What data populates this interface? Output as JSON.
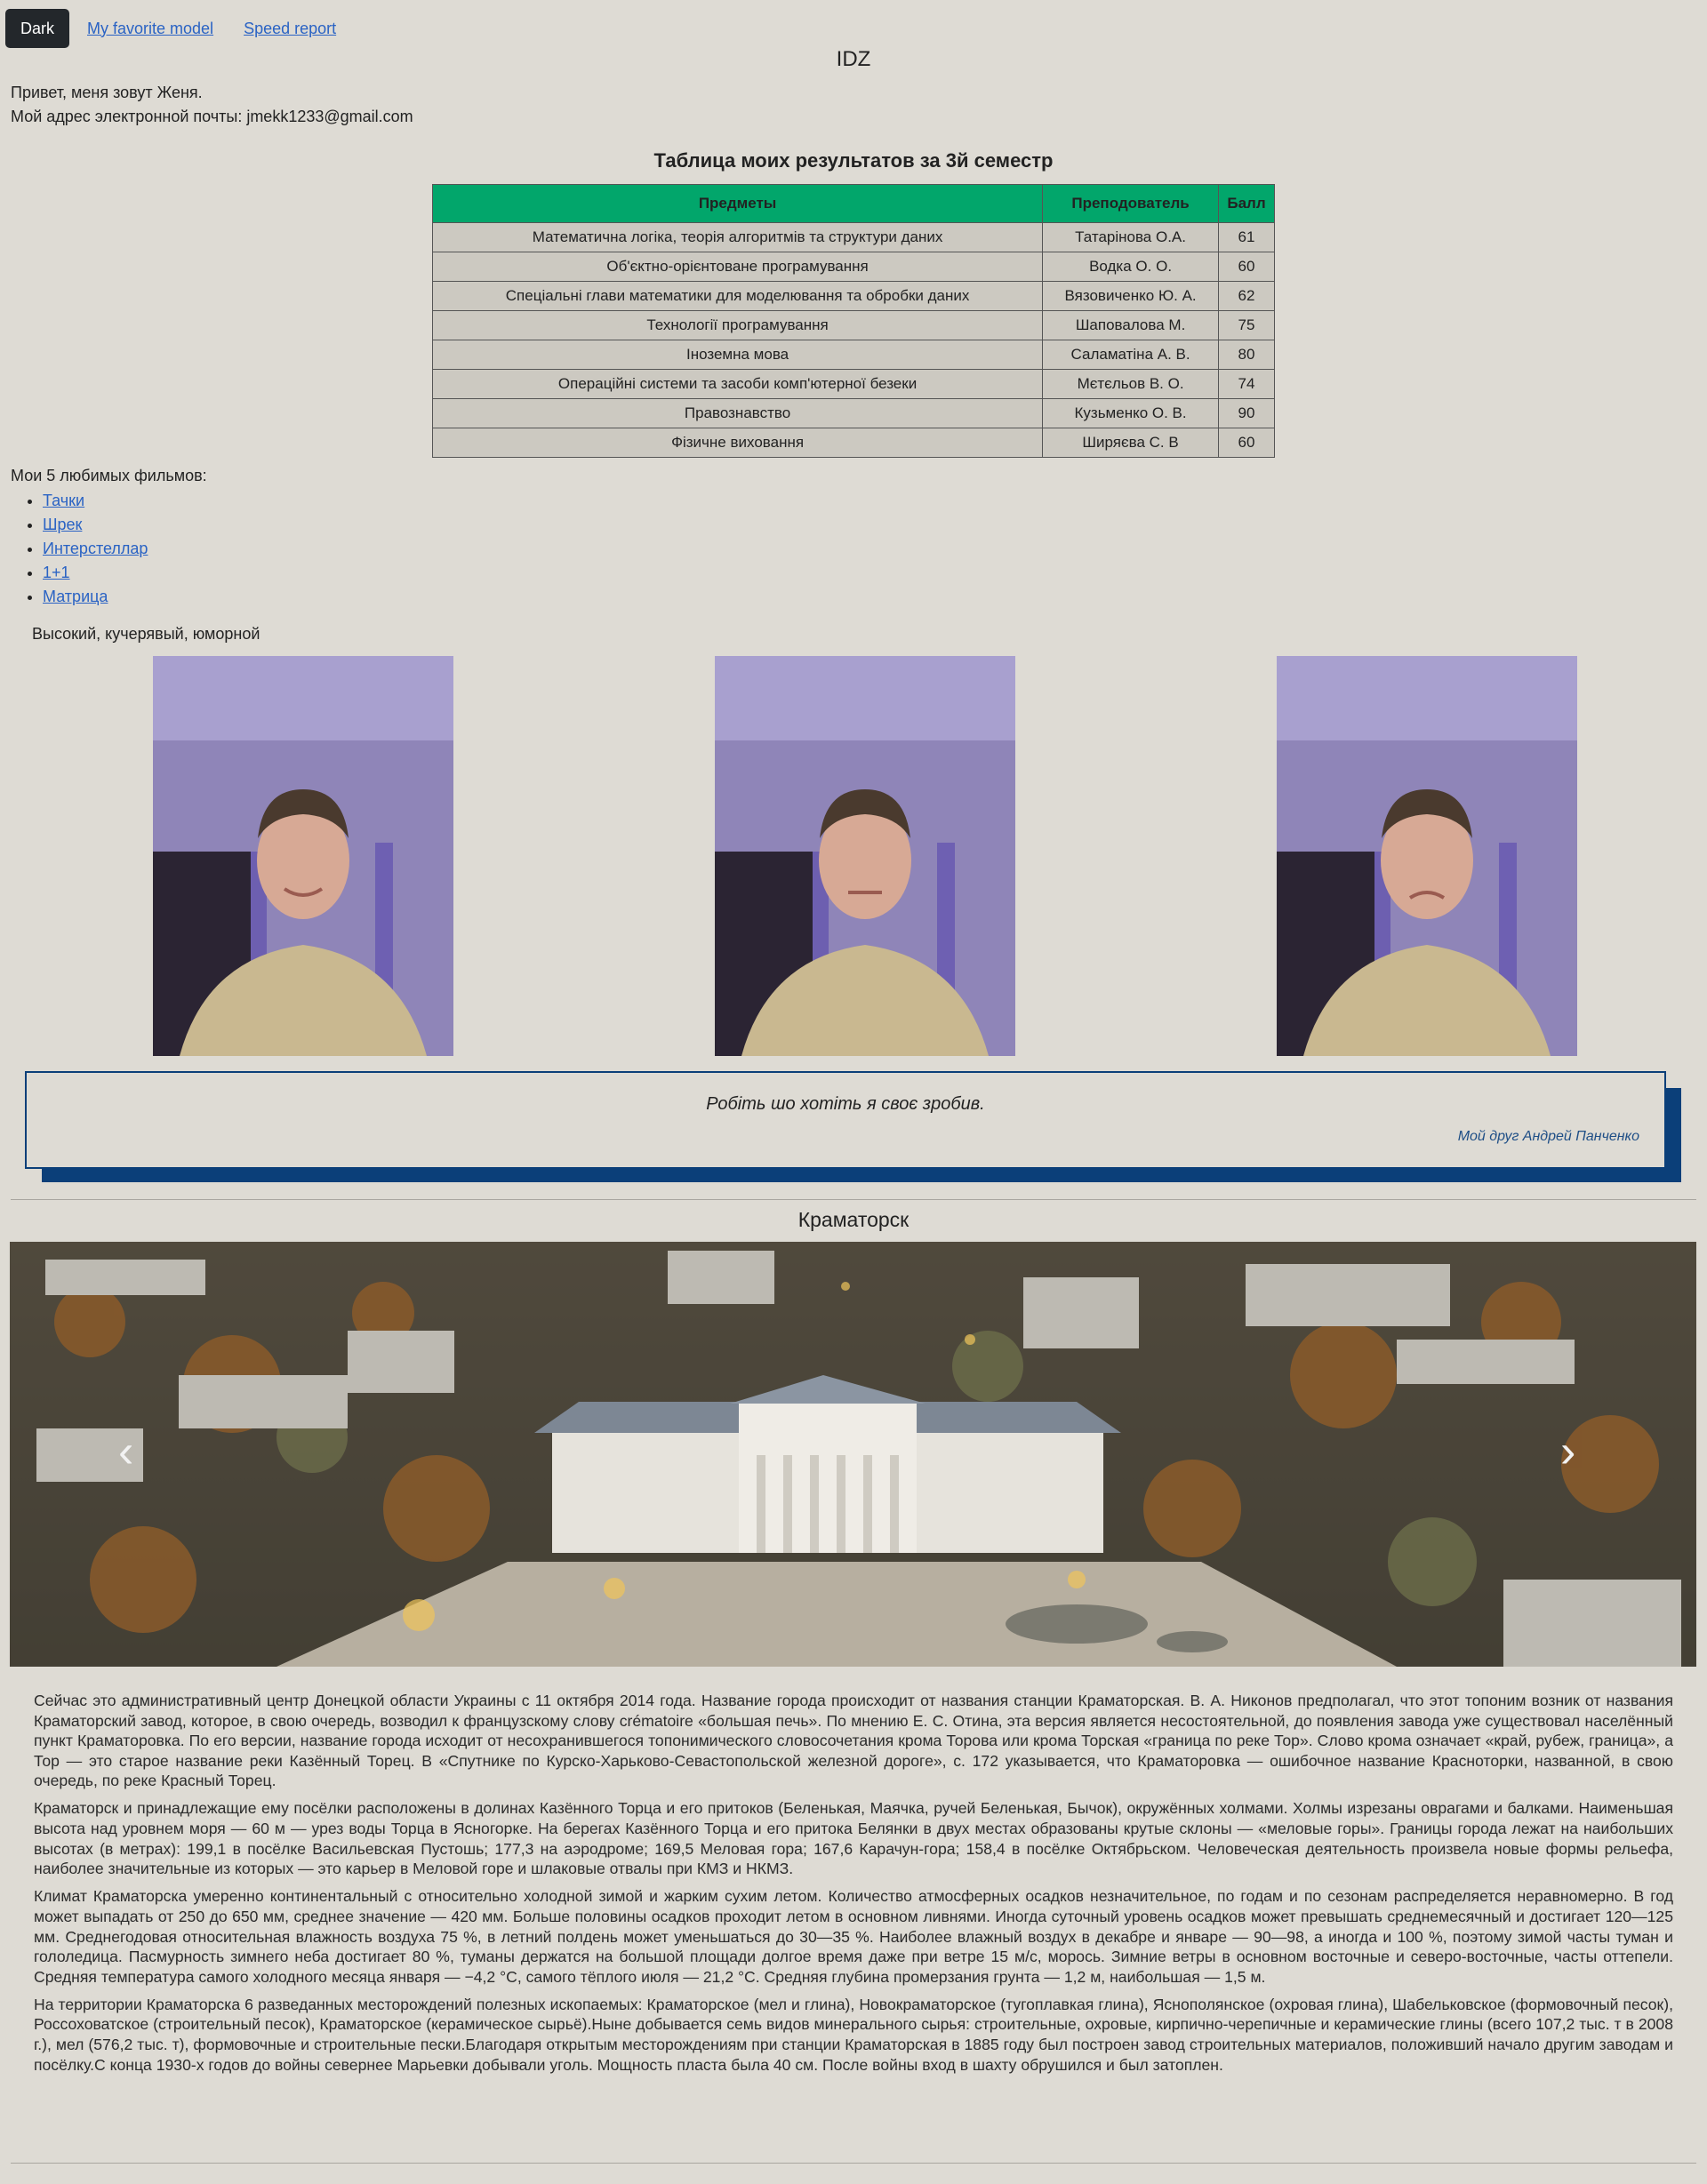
{
  "nav": {
    "theme_button": "Dark",
    "links": [
      "My favorite model",
      "Speed report"
    ]
  },
  "site_title": "IDZ",
  "intro": {
    "line1": "Привет, меня зовут Женя.",
    "line2": "Мой адрес электронной почты: jmekk1233@gmail.com"
  },
  "results": {
    "title": "Таблица моих результатов за 3й семестр",
    "headers": [
      "Предметы",
      "Преподователь",
      "Балл"
    ],
    "rows": [
      [
        "Математична логіка, теорія алгоритмів та структури даних",
        "Татарінова О.А.",
        "61"
      ],
      [
        "Об'єктно-орієнтоване програмування",
        "Водка О. О.",
        "60"
      ],
      [
        "Спеціальні глави математики для моделювання та обробки даних",
        "Вязовиченко Ю. А.",
        "62"
      ],
      [
        "Технології програмування",
        "Шаповалова М.",
        "75"
      ],
      [
        "Іноземна мова",
        "Саламатіна А. В.",
        "80"
      ],
      [
        "Операційні системи та засоби комп'ютерної безеки",
        "Мєтєльов В. О.",
        "74"
      ],
      [
        "Правознавство",
        "Кузьменко О. В.",
        "90"
      ],
      [
        "Фізичне виховання",
        "Ширяєва С. В",
        "60"
      ]
    ]
  },
  "movies": {
    "label": "Мои 5 любимых фильмов:",
    "items": [
      "Тачки",
      "Шрек",
      "Интерстеллар",
      "1+1",
      "Матрица"
    ]
  },
  "description": "Высокий, кучерявый, юморной",
  "quote": {
    "text": "Робіть шо хотіть я своє зробив.",
    "author": "Мой друг Андрей Панченко"
  },
  "city": {
    "title": "Краматорск",
    "carousel_prev": "‹",
    "carousel_next": "›",
    "paragraphs": [
      "Сейчас это административный центр Донецкой области Украины с 11 октября 2014 года. Название города происходит от названия станции Краматорская. В. А. Никонов предполагал, что этот топоним возник от названия Краматорский завод, которое, в свою очередь, возводил к французскому слову crématoire «большая печь». По мнению Е. С. Отина, эта версия является несостоятельной, до появления завода уже существовал населённый пункт Краматоровка. По его версии, название города исходит от несохранившегося топонимического словосочетания крома Торова или крома Торская «граница по реке Тор». Слово крома означает «край, рубеж, граница», а Тор — это старое название реки Казённый Торец. В «Спутнике по Курско-Харьково-Севастопольской железной дороге», с. 172 указывается, что Краматоровка — ошибочное название Красноторки, названной, в свою очередь, по реке Красный Торец.",
      "Краматорск и принадлежащие ему посёлки расположены в долинах Казённого Торца и его притоков (Беленькая, Маячка, ручей Беленькая, Бычок), окружённых холмами. Холмы изрезаны оврагами и балками. Наименьшая высота над уровнем моря — 60 м — урез воды Торца в Ясногорке. На берегах Казённого Торца и его притока Белянки в двух местах образованы крутые склоны — «меловые горы». Границы города лежат на наибольших высотах (в метрах): 199,1 в посёлке Васильевская Пустошь; 177,3 на аэродроме; 169,5 Меловая гора; 167,6 Карачун-гора; 158,4 в посёлке Октябрьском. Человеческая деятельность произвела новые формы рельефа, наиболее значительные из которых — это карьер в Меловой горе и шлаковые отвалы при КМЗ и НКМЗ.",
      "Климат Краматорска умеренно континентальный с относительно холодной зимой и жарким сухим летом. Количество атмосферных осадков незначительное, по годам и по сезонам распределяется неравномерно. В год может выпадать от 250 до 650 мм, среднее значение — 420 мм. Больше половины осадков проходит летом в основном ливнями. Иногда суточный уровень осадков может превышать среднемесячный и достигает 120—125 мм. Среднегодовая относительная влажность воздуха 75 %, в летний полдень может уменьшаться до 30—35 %. Наиболее влажный воздух в декабре и январе — 90—98, а иногда и 100 %, поэтому зимой часты туман и гололедица. Пасмурность зимнего неба достигает 80 %, туманы держатся на большой площади долгое время даже при ветре 15 м/с, морось. Зимние ветры в основном восточные и северо-восточные, часты оттепели. Средняя температура самого холодного месяца января — −4,2 °C, самого тёплого июля — 21,2 °C. Средняя глубина промерзания грунта — 1,2 м, наибольшая — 1,5 м.",
      "На территории Краматорска 6 разведанных месторождений полезных ископаемых: Краматорское (мел и глина), Новокраматорское (тугоплавкая глина), Яснополянское (охровая глина), Шабельковское (формовочный песок), Россоховатское (строительный песок), Краматорское (керамическое сырьё).Ныне добывается семь видов минерального сырья: строительные, охровые, кирпично-черепичные и керамические глины (всего 107,2 тыс. т в 2008 г.), мел (576,2 тыс. т), формовочные и строительные пески.Благодаря открытым месторождениям при станции Краматорская в 1885 году был построен завод строительных материалов, положивший начало другим заводам и посёлку.С конца 1930-х годов до войны севернее Марьевки добывали уголь. Мощность пласта была 40 см. После войны вход в шахту обрушился и был затоплен."
    ]
  }
}
